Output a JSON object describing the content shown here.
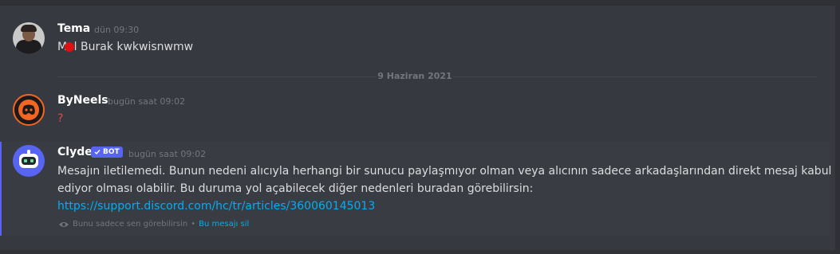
{
  "messages": {
    "tema": {
      "username": "Tema",
      "timestamp": "dün 09:30",
      "text": "Mal Burak kwkwisnwmw"
    },
    "divider": "9 Haziran 2021",
    "byneels": {
      "username": "ByNeels",
      "timestamp": "bugün saat 09:02",
      "text": "?"
    },
    "clyde": {
      "username": "Clyde",
      "bot_tag": "BOT",
      "timestamp": "bugün saat 09:02",
      "line1": "Mesajın iletilemedi. Bunun nedeni alıcıyla herhangi bir sunucu paylaşmıyor olman veya alıcının sadece arkadaşlarından direkt mesaj kabul",
      "line2": "ediyor olması olabilir. Bu duruma yol açabilecek diğer nedenleri buradan görebilirsin:",
      "link": "https://support.discord.com/hc/tr/articles/360060145013",
      "ephemeral_note": "Bunu sadece sen görebilirsin",
      "separator": "•",
      "dismiss": "Bu mesajı sil"
    }
  },
  "colors": {
    "background": "#36393f",
    "link": "#00aff4",
    "accent": "#5865f2",
    "question": "#ed4245"
  }
}
